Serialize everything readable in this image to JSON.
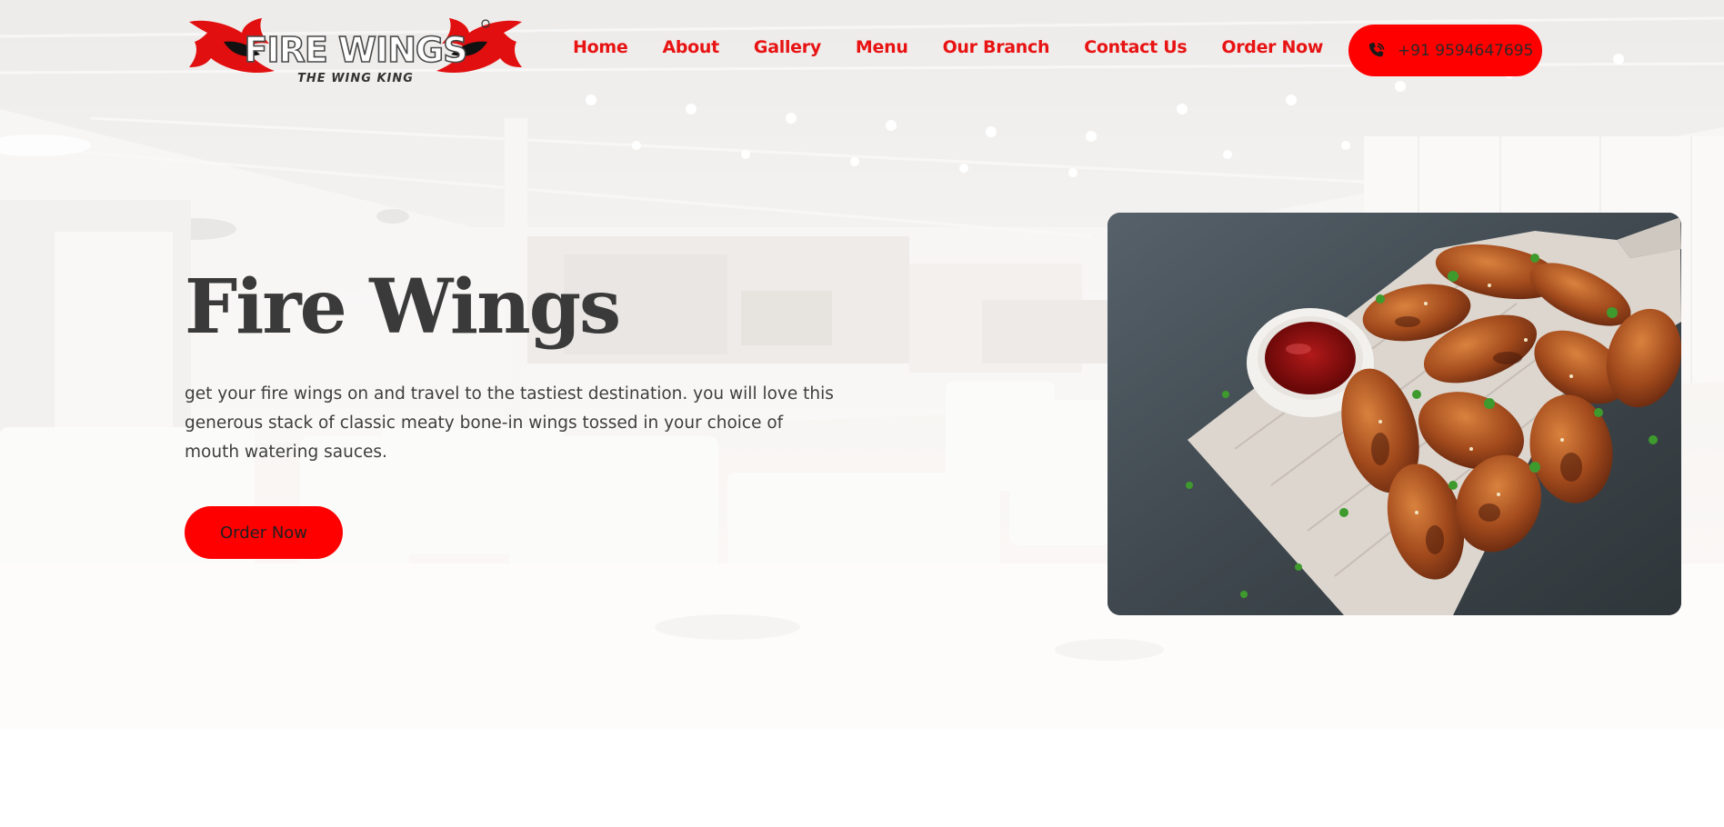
{
  "brand": {
    "logo_text": "FIRE WINGS",
    "logo_tagline": "THE WING KING",
    "accent_color": "#ff0000",
    "nav_text_color": "#e81313"
  },
  "nav": {
    "items": [
      {
        "label": "Home"
      },
      {
        "label": "About"
      },
      {
        "label": "Gallery"
      },
      {
        "label": "Menu"
      },
      {
        "label": "Our Branch"
      },
      {
        "label": "Contact Us"
      },
      {
        "label": "Order Now"
      }
    ]
  },
  "header": {
    "phone_label": "+91 9594647695",
    "phone_icon": "phone-icon"
  },
  "hero": {
    "title": "Fire Wings",
    "description": "get your fire wings on and travel to the tastiest destination. you will love this generous stack of classic meaty bone-in wings tossed in your choice of mouth watering sauces.",
    "cta_label": "Order Now",
    "background": "blurred restaurant interior",
    "image": "chicken wings with dipping sauce on wooden board"
  }
}
